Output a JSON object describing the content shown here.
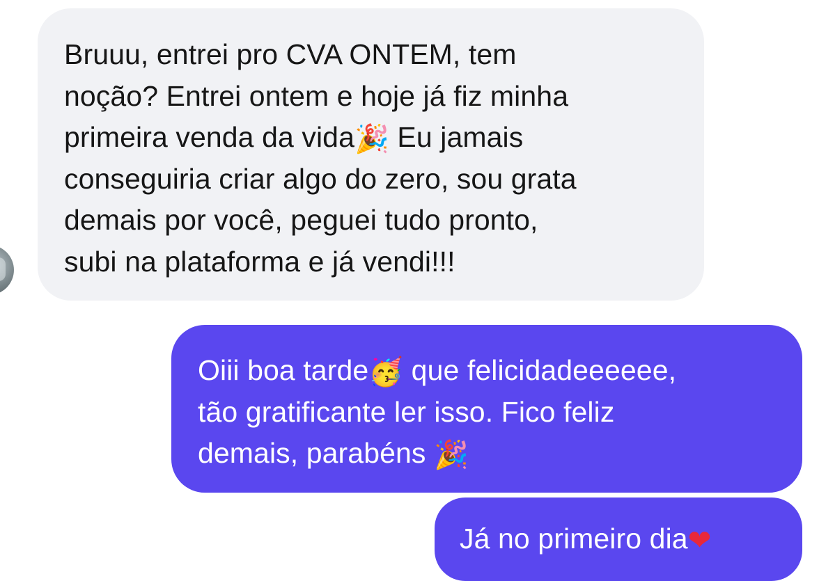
{
  "conversation": {
    "incoming": {
      "lines": [
        "Bruuu, entrei pro CVA ONTEM, tem",
        "noção? Entrei ontem e hoje já fiz minha",
        "primeira venda da vida",
        " Eu jamais",
        "conseguiria criar algo do zero, sou grata",
        "demais por você, peguei tudo pronto,",
        "subi na plataforma e já vendi!!!"
      ],
      "emoji": "🎉"
    },
    "outgoing_1": {
      "lines": [
        "Oiii boa tarde",
        " que felicidadeeeeee,",
        "tão gratificante ler isso. Fico feliz",
        "demais, parabéns "
      ],
      "emoji_face": "🥳",
      "emoji_party": "🎉"
    },
    "outgoing_2": {
      "text": "Já no primeiro dia",
      "emoji": "❤"
    }
  },
  "colors": {
    "incoming_bubble": "#f1f2f5",
    "outgoing_bubble": "#5a47ef",
    "incoming_text": "#161616",
    "outgoing_text": "#ffffff"
  },
  "icons": {
    "avatar": "contact-avatar",
    "party_popper": "party-popper-icon",
    "partying_face": "partying-face-icon",
    "heart": "heart-icon"
  }
}
